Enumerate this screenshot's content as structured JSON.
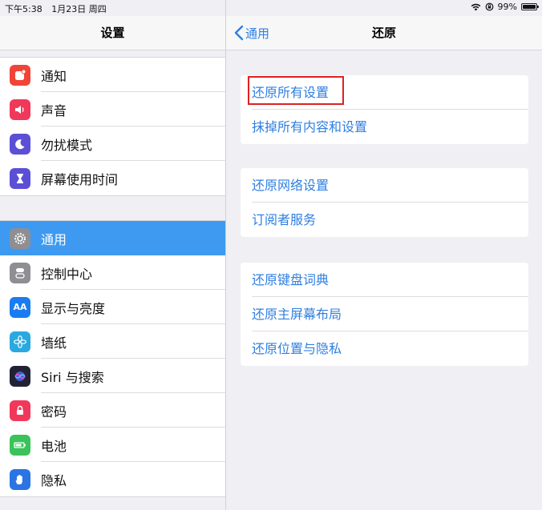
{
  "status_bar": {
    "time": "下午5:38",
    "date": "1月23日 周四",
    "battery": "99%",
    "battery_level": 0.99
  },
  "left": {
    "title": "设置",
    "groups": [
      {
        "items": [
          {
            "label": "通知",
            "icon": "notification-icon",
            "color": "#f04438"
          },
          {
            "label": "声音",
            "icon": "speaker-icon",
            "color": "#f0395a"
          },
          {
            "label": "勿扰模式",
            "icon": "moon-icon",
            "color": "#5b4fd6"
          },
          {
            "label": "屏幕使用时间",
            "icon": "hourglass-icon",
            "color": "#5b4fd6"
          }
        ]
      },
      {
        "items": [
          {
            "label": "通用",
            "icon": "gear-icon",
            "color": "#8e8e93",
            "selected": true
          },
          {
            "label": "控制中心",
            "icon": "toggle-icon",
            "color": "#8e8e93"
          },
          {
            "label": "显示与亮度",
            "icon": "display-icon",
            "color": "#1a7cf0"
          },
          {
            "label": "墙纸",
            "icon": "flower-icon",
            "color": "#2aa9e0"
          },
          {
            "label": "Siri 与搜索",
            "icon": "siri-icon",
            "color": "#222235"
          },
          {
            "label": "密码",
            "icon": "lock-icon",
            "color": "#f0395a"
          },
          {
            "label": "电池",
            "icon": "battery-icon",
            "color": "#39c35a"
          },
          {
            "label": "隐私",
            "icon": "hand-icon",
            "color": "#2a74e4"
          }
        ]
      }
    ]
  },
  "right": {
    "back_label": "通用",
    "title": "还原",
    "groups": [
      {
        "items": [
          "还原所有设置",
          "抹掉所有内容和设置"
        ]
      },
      {
        "items": [
          "还原网络设置",
          "订阅者服务"
        ]
      },
      {
        "items": [
          "还原键盘词典",
          "还原主屏幕布局",
          "还原位置与隐私"
        ]
      }
    ]
  },
  "colors": {
    "accent": "#2f7fe0",
    "selected_row": "#3d9af0",
    "highlight": "#e02020"
  }
}
